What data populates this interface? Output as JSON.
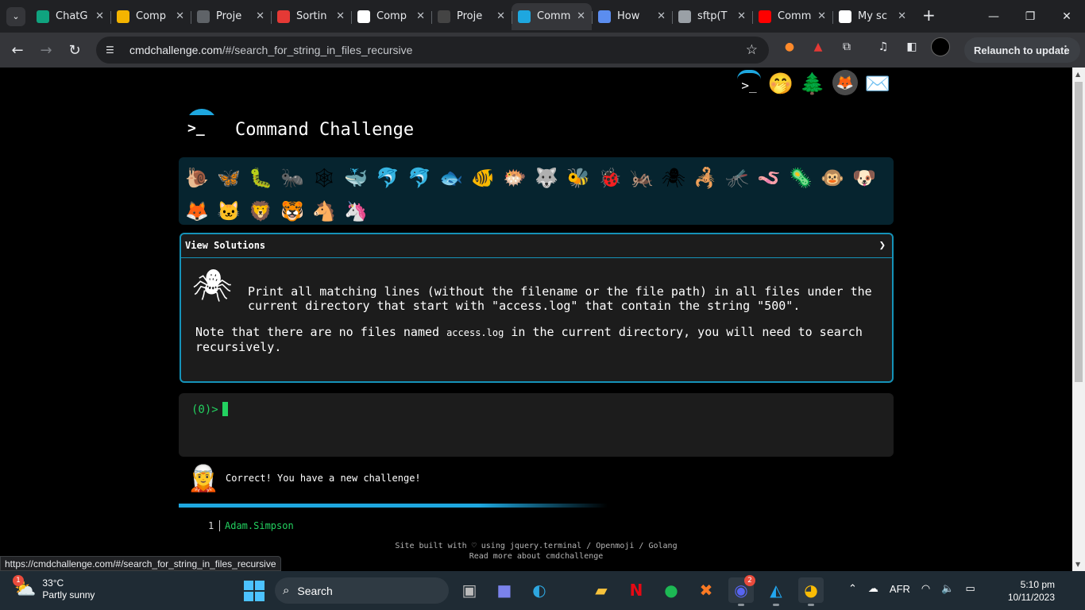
{
  "browser": {
    "tabs": [
      {
        "title": "ChatG",
        "color": "#10a37f"
      },
      {
        "title": "Comp",
        "color": "#f4b400"
      },
      {
        "title": "Proje",
        "color": "#5f6368"
      },
      {
        "title": "Sortin",
        "color": "#e53935"
      },
      {
        "title": "Comp",
        "color": "#ffffff"
      },
      {
        "title": "Proje",
        "color": "#444444"
      },
      {
        "title": "Comm",
        "color": "#1ea7df",
        "active": true
      },
      {
        "title": "How",
        "color": "#5b8def"
      },
      {
        "title": "sftp(T",
        "color": "#9aa0a6"
      },
      {
        "title": "Comm",
        "color": "#ff0000"
      },
      {
        "title": "My sc",
        "color": "#ffffff"
      }
    ],
    "url_host": "cmdchallenge.com",
    "url_path": "/#/search_for_string_in_files_recursive",
    "relaunch_label": "Relaunch to update"
  },
  "page": {
    "title": "Command Challenge",
    "animals": [
      "🐌",
      "🦋",
      "🐛",
      "🐜",
      "🕸",
      "🐳",
      "🐬",
      "🐬",
      "🐟",
      "🐠",
      "🐡",
      "🐺",
      "🐝",
      "🐞",
      "🦗",
      "🕷",
      "🦂",
      "🦟",
      "🪱",
      "🦠",
      "🐵",
      "🐶",
      "🦊",
      "🐱",
      "🦁",
      "🐯",
      "🐴",
      "🦄"
    ],
    "solutions_label": "View Solutions",
    "challenge_text": "Print all matching lines (without the filename or the file path) in all files under the current directory that start with \"access.log\" that contain the string \"500\".",
    "note_part1": "Note that there are no files named ",
    "note_code": "access.log",
    "note_part2": " in the current directory, you will need to search recursively.",
    "terminal_prompt": "(0)>",
    "correct_message": "Correct! You have a new challenge!",
    "leaderboard": [
      {
        "rank": "1",
        "name": "Adam.Simpson"
      }
    ],
    "footer_line1": "Site built with ♡ using jquery.terminal / Openmoji / Golang",
    "footer_line2": "Read more about cmdchallenge"
  },
  "status_url": "https://cmdchallenge.com/#/search_for_string_in_files_recursive",
  "taskbar": {
    "weather_temp": "33°C",
    "weather_desc": "Partly sunny",
    "weather_badge": "1",
    "search_label": "Search",
    "discord_badge": "2",
    "language": "AFR",
    "time": "5:10 pm",
    "date": "10/11/2023"
  }
}
